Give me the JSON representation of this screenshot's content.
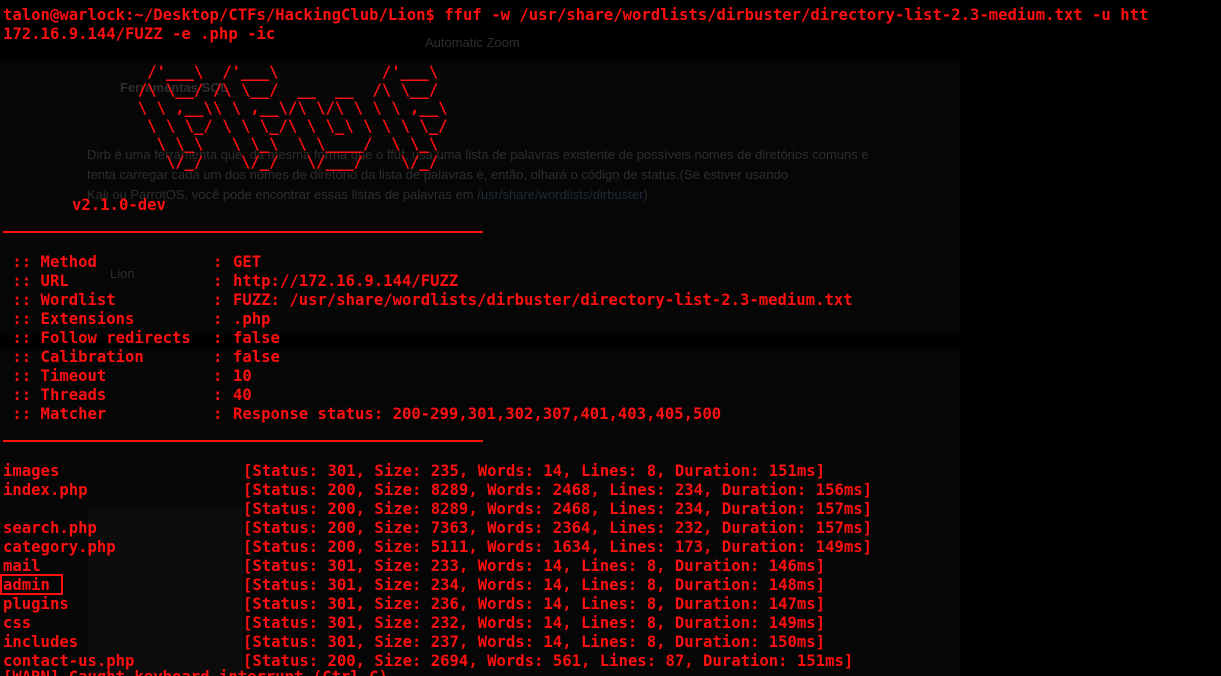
{
  "command": {
    "prompt": "talon@warlock:~/Desktop/CTFs/HackingClub/Lion$",
    "line1": "ffuf -w /usr/share/wordlists/dirbuster/directory-list-2.3-medium.txt -u htt",
    "line2": "172.16.9.144/FUZZ -e .php -ic"
  },
  "banner": {
    "art": "        /'___\\  /'___\\           /'___\\\n       /\\ \\__/ /\\ \\__/  __  __  /\\ \\__/\n       \\ \\ ,__\\\\ \\ ,__\\/\\ \\/\\ \\ \\ \\ ,__\\\n        \\ \\ \\_/ \\ \\ \\_/\\ \\ \\_\\ \\ \\ \\ \\_/\n         \\ \\_\\   \\ \\_\\  \\ \\____/  \\ \\_\\\n          \\/_/    \\/_/   \\/___/    \\/_/",
    "version": "v2.1.0-dev"
  },
  "config": [
    {
      "key": " :: Method",
      "value": "GET"
    },
    {
      "key": " :: URL",
      "value": "http://172.16.9.144/FUZZ"
    },
    {
      "key": " :: Wordlist",
      "value": "FUZZ: /usr/share/wordlists/dirbuster/directory-list-2.3-medium.txt"
    },
    {
      "key": " :: Extensions",
      "value": ".php"
    },
    {
      "key": " :: Follow redirects",
      "value": "false"
    },
    {
      "key": " :: Calibration",
      "value": "false"
    },
    {
      "key": " :: Timeout",
      "value": "10"
    },
    {
      "key": " :: Threads",
      "value": "40"
    },
    {
      "key": " :: Matcher",
      "value": "Response status: 200-299,301,302,307,401,403,405,500"
    }
  ],
  "results": [
    {
      "name": "images",
      "status": "[Status: 301, Size: 235, Words: 14, Lines: 8, Duration: 151ms]"
    },
    {
      "name": "index.php",
      "status": "[Status: 200, Size: 8289, Words: 2468, Lines: 234, Duration: 156ms]"
    },
    {
      "name": "",
      "status": "[Status: 200, Size: 8289, Words: 2468, Lines: 234, Duration: 157ms]"
    },
    {
      "name": "search.php",
      "status": "[Status: 200, Size: 7363, Words: 2364, Lines: 232, Duration: 157ms]"
    },
    {
      "name": "category.php",
      "status": "[Status: 200, Size: 5111, Words: 1634, Lines: 173, Duration: 149ms]"
    },
    {
      "name": "mail",
      "status": "[Status: 301, Size: 233, Words: 14, Lines: 8, Duration: 146ms]"
    },
    {
      "name": "admin",
      "status": "[Status: 301, Size: 234, Words: 14, Lines: 8, Duration: 148ms]"
    },
    {
      "name": "plugins",
      "status": "[Status: 301, Size: 236, Words: 14, Lines: 8, Duration: 147ms]"
    },
    {
      "name": "css",
      "status": "[Status: 301, Size: 232, Words: 14, Lines: 8, Duration: 149ms]"
    },
    {
      "name": "includes",
      "status": "[Status: 301, Size: 237, Words: 14, Lines: 8, Duration: 150ms]"
    },
    {
      "name": "contact-us.php",
      "status": "[Status: 200, Size: 2694, Words: 561, Lines: 87, Duration: 151ms]"
    }
  ],
  "background": {
    "zoom_label": "Automatic Zoom",
    "heading": "Ferramentas SQL",
    "para1": "Dirb é uma ferramenta que, da mesma forma que o ffuf, usa uma lista de palavras existente de possíveis nomes de diretórios comuns e",
    "para2": "tenta carregar cada um dos nomes de diretório da lista de palavras e, então, olhará o código de status.(Se estiver usando",
    "para3": "Kali ou ParrotOS, você pode encontrar essas listas de palavras em",
    "link": "/usr/share/wordlists/dirbuster",
    "tab": "Lion"
  },
  "colors": {
    "text": "#ff0f0f",
    "background": "#000000"
  }
}
